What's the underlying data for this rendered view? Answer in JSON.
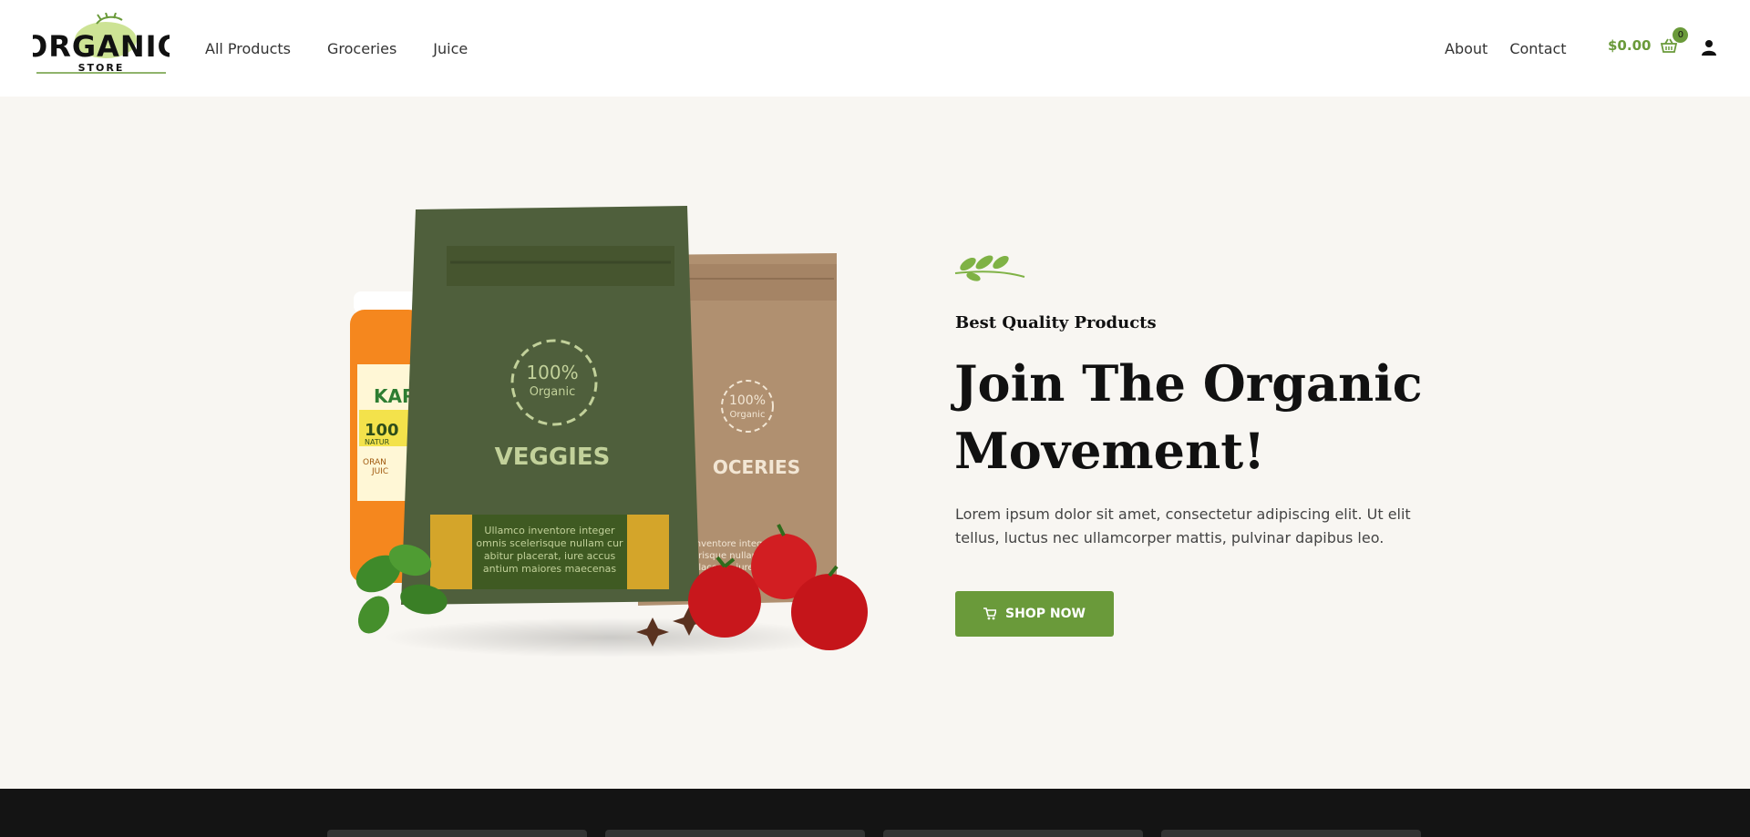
{
  "header": {
    "logo": {
      "word": "ORGANIC",
      "sub": "STORE"
    },
    "nav_left": [
      "All Products",
      "Groceries",
      "Juice"
    ],
    "nav_right": [
      "About",
      "Contact"
    ],
    "cart": {
      "amount": "$0.00",
      "count": "0"
    }
  },
  "hero": {
    "subtitle": "Best Quality Products",
    "title": "Join The Organic Movement!",
    "description": "Lorem ipsum dolor sit amet, consectetur adipiscing elit. Ut elit tellus, luctus nec ullamcorper mattis, pulvinar dapibus leo.",
    "button": "SHOP NOW",
    "product_image": {
      "veggie_bag": {
        "badge_pct": "100%",
        "badge_word": "Organic",
        "label": "VEGGIES",
        "panel_text": [
          "Ullamco inventore integer",
          "omnis scelerisque nullam cur",
          "abitur placerat, iure accus",
          "antium maiores maecenas"
        ]
      },
      "grocery_bag": {
        "badge_pct": "100%",
        "badge_word": "Organic",
        "label": "OCERIES",
        "panel_text": [
          "inventore integ",
          "erisque nullam",
          "placerat, iure"
        ]
      },
      "juice_jar": {
        "brand": "KAR",
        "pct": "100",
        "word": "NATUR",
        "flavor": [
          "ORAN",
          "JUIC"
        ]
      }
    }
  },
  "colors": {
    "accent": "#6a9a3a",
    "dark_strip": "#141414",
    "hero_bg": "#f8f6f2"
  }
}
